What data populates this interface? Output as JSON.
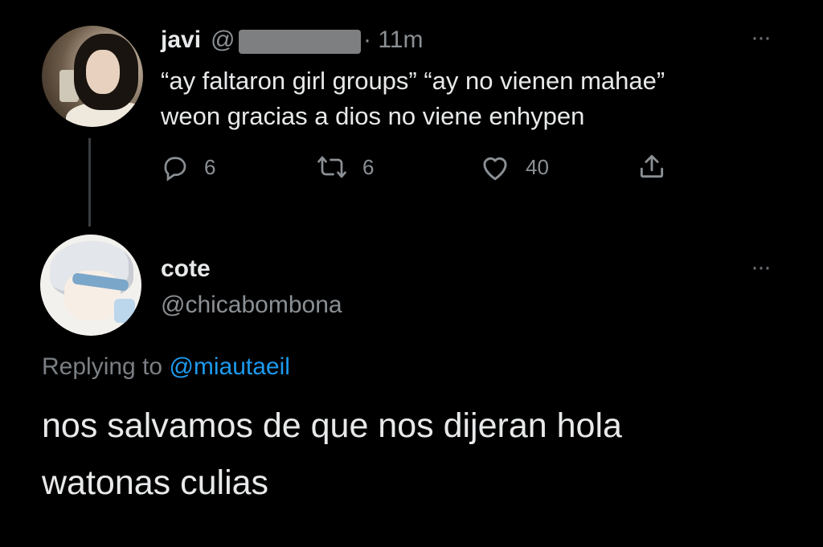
{
  "parent_tweet": {
    "display_name": "javi",
    "handle_prefix": "@",
    "time": "· 11m",
    "more_label": "···",
    "text_line1": "“ay faltaron girl groups” “ay no vienen mahae”",
    "text_line2": "weon gracias a dios no viene enhypen",
    "actions": {
      "reply_icon": "reply-icon",
      "reply_count": "6",
      "retweet_icon": "retweet-icon",
      "retweet_count": "6",
      "like_icon": "heart-icon",
      "like_count": "40",
      "share_icon": "share-icon"
    }
  },
  "reply_tweet": {
    "display_name": "cote",
    "handle": "@chicabombona",
    "more_label": "···",
    "replying_to_label": "Replying to",
    "replying_to_handle": "@miautaeil",
    "text_line1": "nos salvamos de que nos dijeran hola",
    "text_line2": "watonas culias"
  },
  "colors": {
    "background": "#000000",
    "primary_text": "#e7e9ea",
    "secondary_text": "#8b9095",
    "mention": "#1d9bf0"
  }
}
